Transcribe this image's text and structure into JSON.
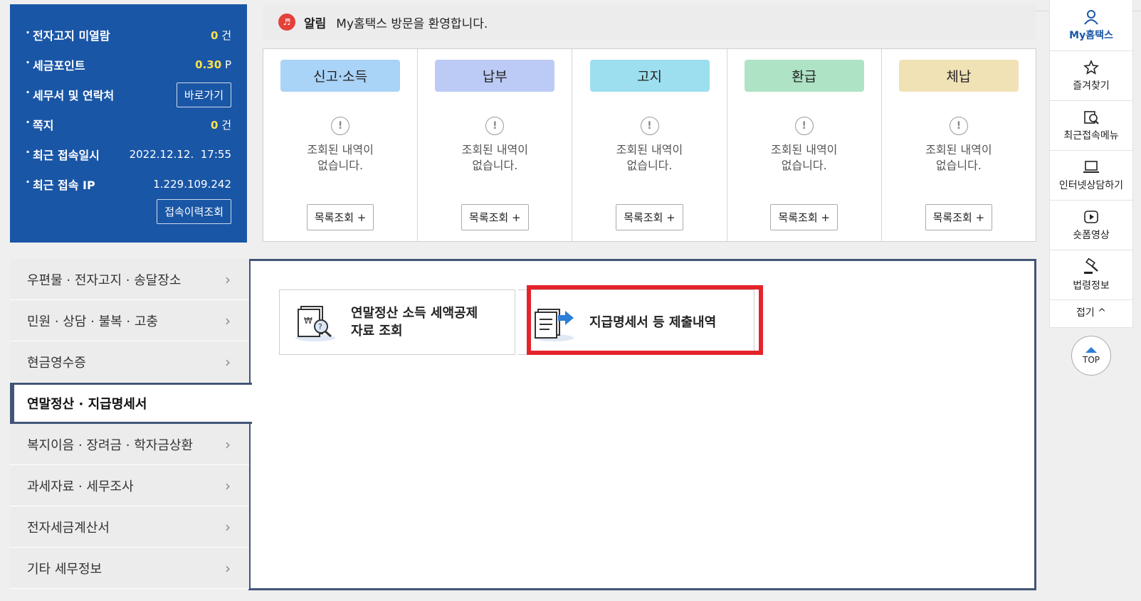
{
  "info_panel": {
    "rows": [
      {
        "label": "전자고지 미열람",
        "value_num": "0",
        "value_unit": " 건"
      },
      {
        "label": "세금포인트",
        "value_num": "0.30",
        "value_unit": " P"
      },
      {
        "label": "세무서 및 연락처",
        "button": "바로가기"
      },
      {
        "label": "쪽지",
        "value_num": "0",
        "value_unit": " 건"
      },
      {
        "label": "최근 접속일시",
        "value_text": "2022.12.12.  17:55"
      },
      {
        "label": "최근 접속 IP",
        "value_text": "1.229.109.242"
      }
    ],
    "history_button": "접속이력조회"
  },
  "notice": {
    "title": "알림",
    "text": "My홈택스 방문을 환영합니다."
  },
  "categories": [
    {
      "label": "신고·소득",
      "color": "#a9d3f7",
      "msg1": "조회된 내역이",
      "msg2": "없습니다.",
      "button": "목록조회 +"
    },
    {
      "label": "납부",
      "color": "#bccbf5",
      "msg1": "조회된 내역이",
      "msg2": "없습니다.",
      "button": "목록조회 +"
    },
    {
      "label": "고지",
      "color": "#9ddfee",
      "msg1": "조회된 내역이",
      "msg2": "없습니다.",
      "button": "목록조회 +"
    },
    {
      "label": "환급",
      "color": "#aee3c5",
      "msg1": "조회된 내역이",
      "msg2": "없습니다.",
      "button": "목록조회 +"
    },
    {
      "label": "체납",
      "color": "#f1e2b6",
      "msg1": "조회된 내역이",
      "msg2": "없습니다.",
      "button": "목록조회 +"
    }
  ],
  "menu": [
    {
      "label": "우편물 · 전자고지 · 송달장소"
    },
    {
      "label": "민원 · 상담 · 불복 · 고충"
    },
    {
      "label": "현금영수증"
    },
    {
      "label": "연말정산 · 지급명세서",
      "active": true
    },
    {
      "label": "복지이음 · 장려금 · 학자금상환"
    },
    {
      "label": "과세자료 · 세무조사"
    },
    {
      "label": "전자세금계산서"
    },
    {
      "label": "기타 세무정보"
    }
  ],
  "cards": [
    {
      "line1": "연말정산 소득 세액공제",
      "line2": "자료 조회",
      "icon": "document-search-icon"
    },
    {
      "line1": "지급명세서 등 제출내역",
      "line2": "",
      "icon": "document-send-icon"
    }
  ],
  "quickbar": {
    "items": [
      {
        "label": "My홈택스",
        "icon": "user-icon"
      },
      {
        "label": "즐겨찾기",
        "icon": "star-icon"
      },
      {
        "label": "최근접속메뉴",
        "icon": "recent-menu-icon"
      },
      {
        "label": "인터넷상담하기",
        "icon": "laptop-icon"
      },
      {
        "label": "숏폼영상",
        "icon": "play-icon"
      },
      {
        "label": "법령정보",
        "icon": "gavel-icon"
      }
    ],
    "fold": "접기 ^",
    "top": "TOP"
  },
  "colors": {
    "panel_blue": "#1a56a6",
    "highlight_red": "#e4232a",
    "value_yellow": "#ffe14d",
    "active_border": "#435577"
  }
}
